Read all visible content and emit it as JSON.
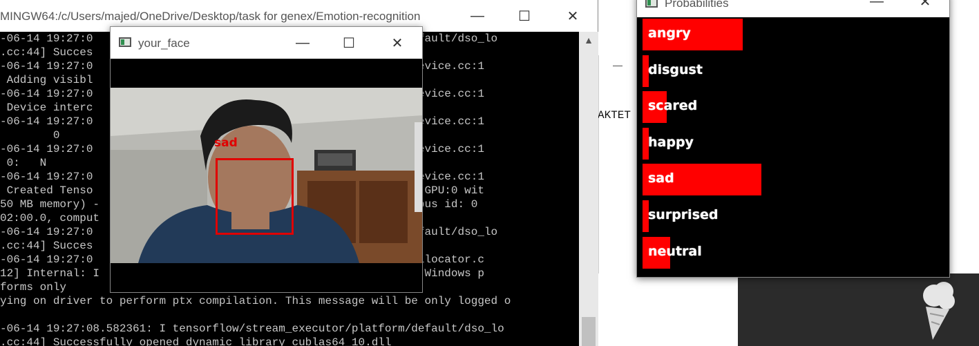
{
  "terminal": {
    "title": "MINGW64:/c/Users/majed/OneDrive/Desktop/task for genex/Emotion-recognition",
    "lines": [
      "-06-14 19:27:0                                      platform/default/dso_lo",
      ".cc:44] Succes                                      ll",
      "-06-14 19:27:0                                      e/gpu/gpu_device.cc:1",
      " Adding visibl",
      "-06-14 19:27:0                                      e/gpu/gpu_device.cc:1",
      " Device interc                                      e matrix:",
      "-06-14 19:27:0                                      e/gpu/gpu_device.cc:1",
      "        0",
      "-06-14 19:27:0                                      e/gpu/gpu_device.cc:1",
      " 0:   N",
      "-06-14 19:27:0                                      e/gpu/gpu_device.cc:1",
      " Created Tenso                                      sk:0/device:GPU:0 wit",
      "50 MB memory) -                                     MX150, pci bus id: 0",
      "02:00.0, comput",
      "-06-14 19:27:0                                      platform/default/dso_lo",
      ".cc:44] Succes                                      ll",
      "-06-14 19:27:0                                      u/redzone_allocator.c",
      "12] Internal: I                                     on Cuda non-Windows p",
      "forms only",
      "ying on driver to perform ptx compilation. This message will be only logged o",
      "",
      "-06-14 19:27:08.582361: I tensorflow/stream_executor/platform/default/dso_lo",
      ".cc:44] Successfully opened dynamic library cublas64_10.dll"
    ]
  },
  "face_window": {
    "title": "your_face",
    "detection_label": "sad"
  },
  "prob_window": {
    "title": "Probabilities",
    "emotions": [
      {
        "label": "angry",
        "value": 0.33
      },
      {
        "label": "disgust",
        "value": 0.02
      },
      {
        "label": "scared",
        "value": 0.08
      },
      {
        "label": "happy",
        "value": 0.02
      },
      {
        "label": "sad",
        "value": 0.39
      },
      {
        "label": "surprised",
        "value": 0.02
      },
      {
        "label": "neutral",
        "value": 0.09
      }
    ]
  },
  "background_window": {
    "text": "AKTET"
  },
  "colors": {
    "bar": "#ff0000",
    "detection": "#e00000",
    "terminal_text": "#c8c8c8"
  }
}
